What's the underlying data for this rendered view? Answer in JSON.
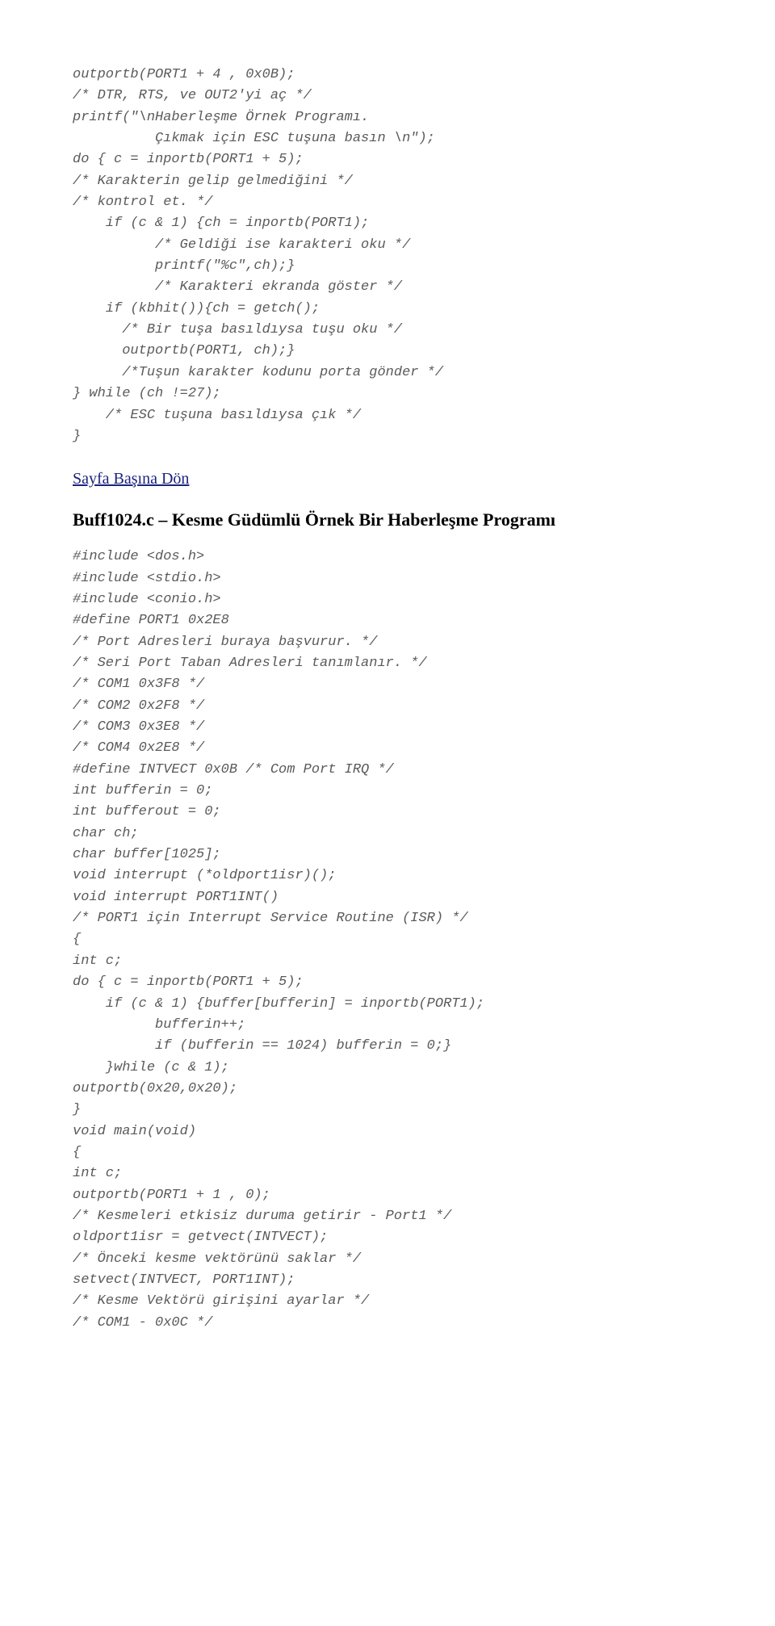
{
  "codeBlock1": "outportb(PORT1 + 4 , 0x0B);\n/* DTR, RTS, ve OUT2'yi aç */\nprintf(\"\\nHaberleşme Örnek Programı.\n          Çıkmak için ESC tuşuna basın \\n\");\ndo { c = inportb(PORT1 + 5);\n/* Karakterin gelip gelmediğini */\n/* kontrol et. */\n    if (c & 1) {ch = inportb(PORT1);\n          /* Geldiği ise karakteri oku */\n          printf(\"%c\",ch);}\n          /* Karakteri ekranda göster */\n    if (kbhit()){ch = getch();\n      /* Bir tuşa basıldıysa tuşu oku */\n      outportb(PORT1, ch);}\n      /*Tuşun karakter kodunu porta gönder */\n} while (ch !=27);\n    /* ESC tuşuna basıldıysa çık */\n}",
  "linkText": "Sayfa Başına Dön",
  "headingText": "Buff1024.c – Kesme Güdümlü Örnek Bir Haberleşme Programı",
  "codeBlock2": "#include <dos.h>\n#include <stdio.h>\n#include <conio.h>\n#define PORT1 0x2E8\n/* Port Adresleri buraya başvurur. */\n/* Seri Port Taban Adresleri tanımlanır. */\n/* COM1 0x3F8 */\n/* COM2 0x2F8 */\n/* COM3 0x3E8 */\n/* COM4 0x2E8 */\n#define INTVECT 0x0B /* Com Port IRQ */\nint bufferin = 0;\nint bufferout = 0;\nchar ch;\nchar buffer[1025];\nvoid interrupt (*oldport1isr)();\nvoid interrupt PORT1INT()\n/* PORT1 için Interrupt Service Routine (ISR) */\n{\nint c;\ndo { c = inportb(PORT1 + 5);\n    if (c & 1) {buffer[bufferin] = inportb(PORT1);\n          bufferin++;\n          if (bufferin == 1024) bufferin = 0;}\n    }while (c & 1);\noutportb(0x20,0x20);\n}\nvoid main(void)\n{\nint c;\noutportb(PORT1 + 1 , 0);\n/* Kesmeleri etkisiz duruma getirir - Port1 */\noldport1isr = getvect(INTVECT);\n/* Önceki kesme vektörünü saklar */\nsetvect(INTVECT, PORT1INT);\n/* Kesme Vektörü girişini ayarlar */\n/* COM1 - 0x0C */"
}
